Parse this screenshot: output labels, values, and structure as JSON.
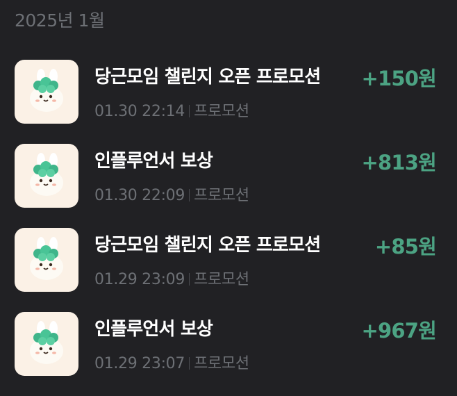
{
  "header": {
    "month": "2025년 1월"
  },
  "transactions": [
    {
      "title": "당근모임 챌린지 오픈 프로모션",
      "date": "01.30 22:14",
      "category": "프로모션",
      "amount": "+150원"
    },
    {
      "title": "인플루언서 보상",
      "date": "01.30 22:09",
      "category": "프로모션",
      "amount": "+813원"
    },
    {
      "title": "당근모임 챌린지 오픈 프로모션",
      "date": "01.29 23:09",
      "category": "프로모션",
      "amount": "+85원"
    },
    {
      "title": "인플루언서 보상",
      "date": "01.29 23:07",
      "category": "프로모션",
      "amount": "+967원"
    }
  ],
  "colors": {
    "background": "#212124",
    "amount": "#4ca383",
    "muted": "#6d7075",
    "thumb_bg": "#fbf1e6"
  },
  "icons": {
    "thumbnail": "carrot-bunny-mascot-icon"
  }
}
